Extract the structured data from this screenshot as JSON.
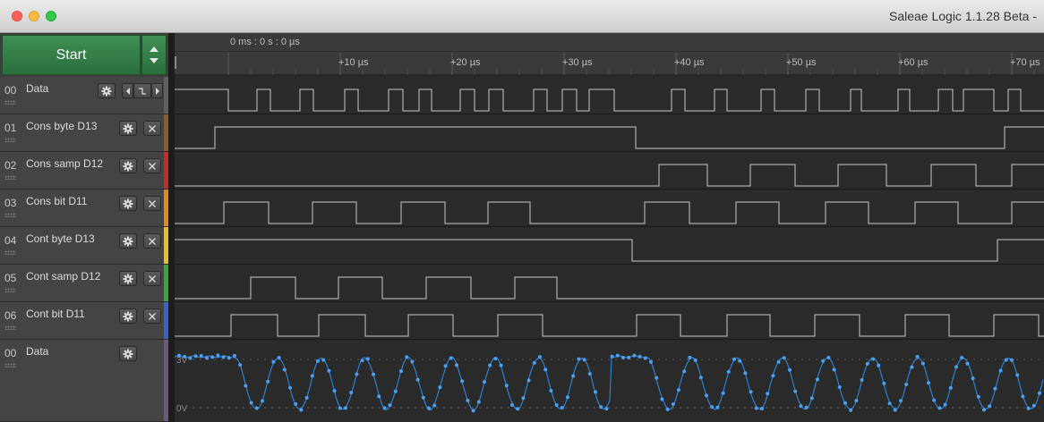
{
  "window": {
    "title": "Saleae Logic 1.1.28 Beta - "
  },
  "controls": {
    "start_label": "Start"
  },
  "channels": [
    {
      "num": "00",
      "name": "Data",
      "color": "#606060",
      "buttons": [
        "gear",
        "prev",
        "edge",
        "next"
      ]
    },
    {
      "num": "01",
      "name": "Cons byte D13",
      "color": "#8a5a2b",
      "buttons": [
        "gear",
        "close"
      ]
    },
    {
      "num": "02",
      "name": "Cons samp D12",
      "color": "#c82a2a",
      "buttons": [
        "gear",
        "close"
      ]
    },
    {
      "num": "03",
      "name": "Cons bit D11",
      "color": "#e08a1e",
      "buttons": [
        "gear",
        "close"
      ]
    },
    {
      "num": "04",
      "name": "Cont byte D13",
      "color": "#e6c21e",
      "buttons": [
        "gear",
        "close"
      ]
    },
    {
      "num": "05",
      "name": "Cont samp D12",
      "color": "#3fa23f",
      "buttons": [
        "gear",
        "close"
      ]
    },
    {
      "num": "06",
      "name": "Cont bit D11",
      "color": "#3a63c8",
      "buttons": [
        "gear",
        "close"
      ]
    },
    {
      "num": "00",
      "name": "Data",
      "color": "#6a5a7a",
      "buttons": [
        "gear"
      ]
    }
  ],
  "timeline": {
    "origin_label": "0 ms : 0 s : 0 µs",
    "ticks": [
      "+10 µs",
      "+20 µs",
      "+30 µs",
      "+40 µs",
      "+50 µs",
      "+60 µs",
      "+70 µs"
    ]
  },
  "analog": {
    "label_high": "3V",
    "label_low": "0V",
    "line_color": "#2f7fd0",
    "dot_color": "#4aa0f0"
  }
}
